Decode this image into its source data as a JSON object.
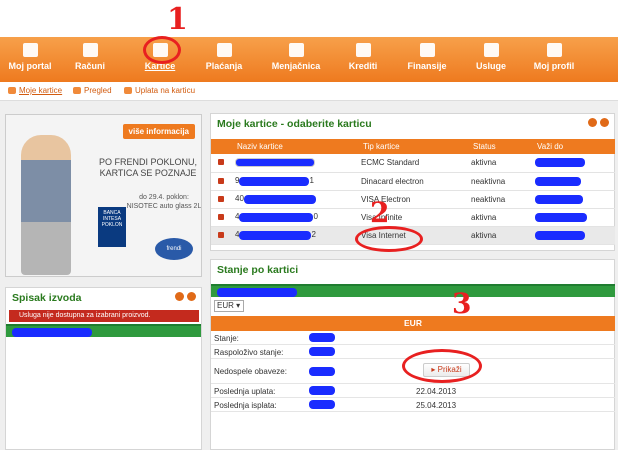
{
  "nav": {
    "items": [
      {
        "label": "Moj portal",
        "icon": "monitor-icon"
      },
      {
        "label": "Računi",
        "icon": "bar-chart-icon"
      },
      {
        "label": "Kartice",
        "icon": "cards-icon"
      },
      {
        "label": "Plaćanja",
        "icon": "payment-icon"
      },
      {
        "label": "Menjačnica",
        "icon": "exchange-icon"
      },
      {
        "label": "Krediti",
        "icon": "loan-icon"
      },
      {
        "label": "Finansije",
        "icon": "piggy-bank-icon"
      },
      {
        "label": "Usluge",
        "icon": "plus-icon"
      },
      {
        "label": "Moj profil",
        "icon": "users-icon"
      }
    ]
  },
  "subnav": {
    "items": [
      {
        "label": "Moje kartice"
      },
      {
        "label": "Pregled"
      },
      {
        "label": "Uplata na karticu"
      }
    ]
  },
  "banner": {
    "button": "više informacija",
    "headline": "PO FRENDI POKLONU, KARTICA SE POZNAJE",
    "small": "do 29.4. poklon: NISOTEC auto glass 2L",
    "poklon": "BANCA INTESA POKLON",
    "logo": "frendi"
  },
  "cards": {
    "title": "Moje kartice - odaberite karticu",
    "headers": [
      "Naziv kartice",
      "Tip kartice",
      "Status",
      "Važi do"
    ],
    "rows": [
      {
        "num_start": "",
        "num_end": "",
        "type": "ECMC Standard",
        "status": "aktivna"
      },
      {
        "num_start": "9",
        "num_end": "1",
        "type": "Dinacard electron",
        "status": "neaktivna"
      },
      {
        "num_start": "40",
        "num_end": "",
        "type": "VISA Electron",
        "status": "neaktivna"
      },
      {
        "num_start": "4",
        "num_end": "0",
        "type": "Visa Infinite",
        "status": "aktivna"
      },
      {
        "num_start": "4",
        "num_end": "2",
        "type": "Visa Internet",
        "status": "aktivna"
      }
    ]
  },
  "izvodi": {
    "title": "Spisak izvoda",
    "error": "Usluga nije dostupna za izabrani proizvod."
  },
  "stanje": {
    "title": "Stanje po kartici",
    "currency_select": "EUR",
    "currency_bar": "EUR",
    "button": "Prikaži",
    "rows": [
      {
        "label": "Stanje:",
        "value": ""
      },
      {
        "label": "Raspoloživo stanje:",
        "value": ""
      },
      {
        "label": "Nedospele obaveze:",
        "value": ""
      },
      {
        "label": "Poslednja uplata:",
        "value": "22.04.2013"
      },
      {
        "label": "Poslednja isplata:",
        "value": "25.04.2013"
      }
    ]
  },
  "annotations": [
    "1",
    "2",
    "3"
  ],
  "colors": {
    "accent": "#ee7a1f",
    "green": "#2f9a3e",
    "title_green": "#2a7a1e",
    "annotation_red": "#e82020",
    "redaction_blue": "#1a2cff"
  }
}
